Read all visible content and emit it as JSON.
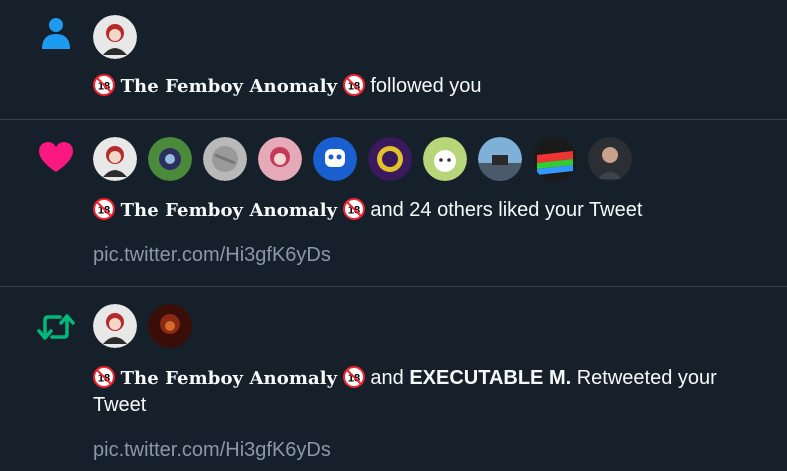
{
  "notifications": [
    {
      "type": "follow",
      "icon": "person-icon",
      "icon_color": "#1d9bf0",
      "actor_badge": "🔞",
      "actor_name": "The Femboy Anomaly",
      "action_text": "followed you"
    },
    {
      "type": "like",
      "icon": "heart-icon",
      "icon_color": "#f91880",
      "actor_badge": "🔞",
      "actor_name": "The Femboy Anomaly",
      "action_text": "and 24 others liked your Tweet",
      "tweet_preview": "pic.twitter.com/Hi3gfK6yDs"
    },
    {
      "type": "retweet",
      "icon": "retweet-icon",
      "icon_color": "#00ba7c",
      "actor_badge": "🔞",
      "actor_name": "The Femboy Anomaly",
      "connector": "and",
      "second_actor": "EXECUTABLE M.",
      "action_text": "Retweeted your Tweet",
      "tweet_preview": "pic.twitter.com/Hi3gfK6yDs"
    }
  ]
}
